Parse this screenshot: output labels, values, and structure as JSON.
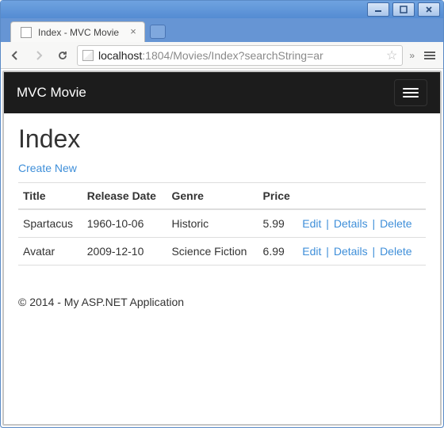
{
  "window": {
    "tab_title": "Index - MVC Movie",
    "url_scheme_host_dim": "localhost",
    "url_port": ":1804",
    "url_path": "/Movies/Index?searchString=ar"
  },
  "navbar": {
    "brand": "MVC Movie"
  },
  "page": {
    "heading": "Index",
    "create_link": "Create New",
    "columns": {
      "title": "Title",
      "release_date": "Release Date",
      "genre": "Genre",
      "price": "Price",
      "actions": ""
    },
    "rows": [
      {
        "title": "Spartacus",
        "release_date": "1960-10-06",
        "genre": "Historic",
        "price": "5.99"
      },
      {
        "title": "Avatar",
        "release_date": "2009-12-10",
        "genre": "Science Fiction",
        "price": "6.99"
      }
    ],
    "actions": {
      "edit": "Edit",
      "details": "Details",
      "delete": "Delete",
      "sep": "|"
    }
  },
  "footer": {
    "text": "© 2014 - My ASP.NET Application"
  }
}
